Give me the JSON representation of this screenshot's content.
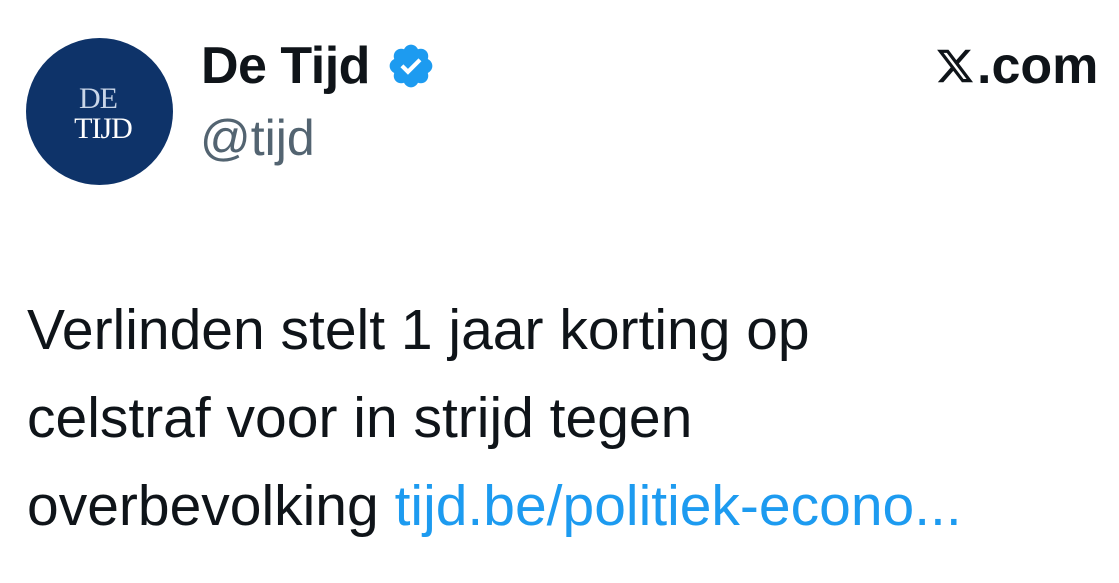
{
  "author": {
    "display_name": "De Tijd",
    "handle": "@tijd",
    "verified": true,
    "avatar_text_top": "DE",
    "avatar_text_bottom": "TIJD",
    "avatar_bg_color": "#0e3369",
    "verified_icon": "verified-badge-icon",
    "verified_color": "#1d9bf0"
  },
  "source": {
    "icon": "x-logo-icon",
    "label": ".com"
  },
  "tweet": {
    "line1": "Verlinden stelt 1 jaar korting op",
    "line2": "celstraf voor in strijd tegen",
    "line3_text": "overbevolking ",
    "link_text": "tijd.be/politiek-econo...",
    "link_color": "#1d9bf0"
  }
}
